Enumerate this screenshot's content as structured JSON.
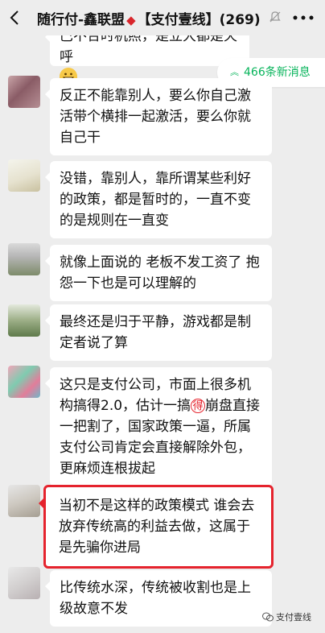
{
  "header": {
    "group_name": "随行付-鑫联盟",
    "group_suffix": "【支付壹线】(269)"
  },
  "new_messages_label": "466条新消息",
  "messages": [
    {
      "text": "巴不合时机照，是立大都是天呼"
    },
    {
      "text": "反正不能靠别人，要么你自己激活带个横排一起激活，要么你就自己干"
    },
    {
      "text": "没错，靠别人，靠所谓某些利好的政策，都是暂时的，一直不变的是规则在一直变"
    },
    {
      "text": "就像上面说的 老板不发工资了 抱怨一下也是可以理解的"
    },
    {
      "text": "最终还是归于平静，游戏都是制定者说了算"
    },
    {
      "text_before": "这只是支付公司，市面上很多机构搞得2.0，估计一搞",
      "badge": "得",
      "text_after": "崩盘直接一把割了，国家政策一逼，所属支付公司肯定会直接解除外包，更麻烦连根拔起"
    },
    {
      "text": "当初不是这样的政策模式 谁会去放弃传统高的利益去做，这属于是先骗你进局"
    },
    {
      "text": "比传统水深，传统被收割也是上级故意不发"
    }
  ],
  "watermark": "支付壹线",
  "colors": {
    "accent_green": "#07b45b",
    "highlight_red": "#e5232d",
    "background": "#ededed"
  }
}
